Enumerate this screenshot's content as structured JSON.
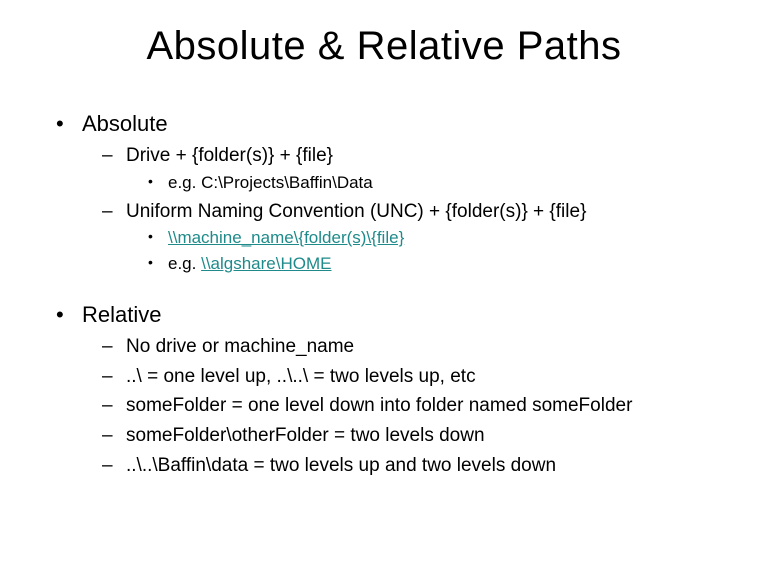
{
  "title": "Absolute &  Relative Paths",
  "sections": [
    {
      "heading": "Absolute",
      "items": [
        {
          "text": "Drive + {folder(s)} + {file}",
          "sub": [
            {
              "text": "e.g. C:\\Projects\\Baffin\\Data",
              "link": false
            }
          ]
        },
        {
          "text": "Uniform Naming Convention (UNC) + {folder(s)} + {file}",
          "sub": [
            {
              "text": "\\\\machine_name\\{folder(s)\\{file}",
              "link": true
            },
            {
              "prefix": "e.g. ",
              "text": "\\\\algshare\\HOME",
              "link": true
            }
          ]
        }
      ]
    },
    {
      "heading": "Relative",
      "items": [
        {
          "text": "No drive or machine_name"
        },
        {
          "text": "..\\ = one level up, ..\\..\\ = two levels up, etc"
        },
        {
          "text": "someFolder = one level down into folder named someFolder"
        },
        {
          "text": "someFolder\\otherFolder = two levels down"
        },
        {
          "text": "..\\..\\Baffin\\data = two levels up and two levels down"
        }
      ]
    }
  ]
}
